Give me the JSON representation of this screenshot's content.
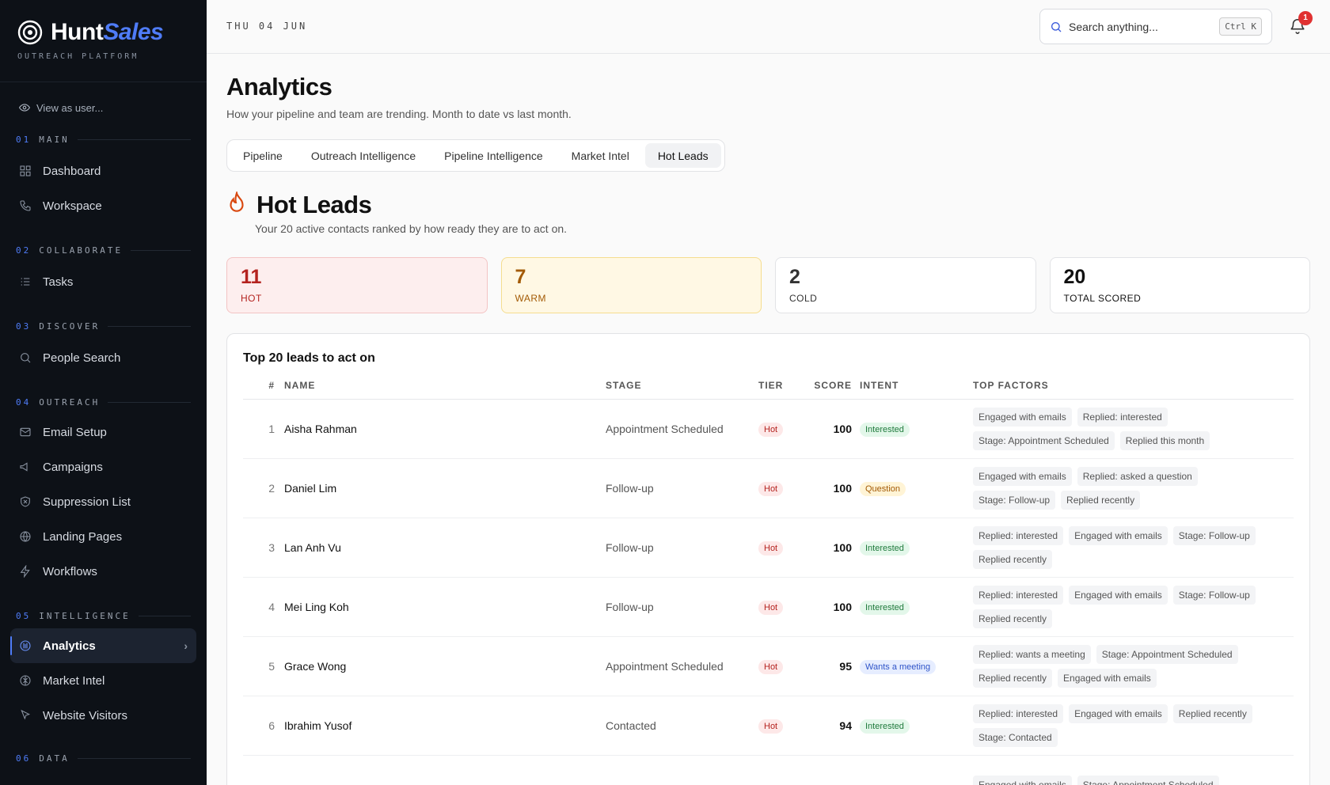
{
  "brand": {
    "name_part1": "Hunt",
    "name_part2": "Sales",
    "tagline": "OUTREACH PLATFORM"
  },
  "sidebar": {
    "view_as": "View as user...",
    "sections": [
      {
        "num": "01",
        "label": "MAIN",
        "items": [
          {
            "label": "Dashboard",
            "icon": "grid-icon"
          },
          {
            "label": "Workspace",
            "icon": "phone-icon"
          }
        ]
      },
      {
        "num": "02",
        "label": "COLLABORATE",
        "items": [
          {
            "label": "Tasks",
            "icon": "list-icon"
          }
        ]
      },
      {
        "num": "03",
        "label": "DISCOVER",
        "items": [
          {
            "label": "People Search",
            "icon": "search-icon"
          }
        ]
      },
      {
        "num": "04",
        "label": "OUTREACH",
        "items": [
          {
            "label": "Email Setup",
            "icon": "mail-icon"
          },
          {
            "label": "Campaigns",
            "icon": "megaphone-icon"
          },
          {
            "label": "Suppression List",
            "icon": "shield-icon"
          },
          {
            "label": "Landing Pages",
            "icon": "globe-icon"
          },
          {
            "label": "Workflows",
            "icon": "bolt-icon"
          }
        ]
      },
      {
        "num": "05",
        "label": "INTELLIGENCE",
        "items": [
          {
            "label": "Analytics",
            "icon": "analytics-icon",
            "active": true
          },
          {
            "label": "Market Intel",
            "icon": "brain-icon"
          },
          {
            "label": "Website Visitors",
            "icon": "cursor-icon"
          }
        ]
      },
      {
        "num": "06",
        "label": "DATA",
        "items": []
      }
    ]
  },
  "topbar": {
    "date": "THU 04 JUN",
    "search_placeholder": "Search anything...",
    "shortcut": "Ctrl K",
    "notifications": "1"
  },
  "page": {
    "title": "Analytics",
    "subtitle": "How your pipeline and team are trending. Month to date vs last month."
  },
  "tabs": [
    {
      "label": "Pipeline"
    },
    {
      "label": "Outreach Intelligence"
    },
    {
      "label": "Pipeline Intelligence"
    },
    {
      "label": "Market Intel"
    },
    {
      "label": "Hot Leads",
      "active": true
    }
  ],
  "hot_leads": {
    "title": "Hot Leads",
    "subtitle": "Your 20 active contacts ranked by how ready they are to act on.",
    "stats": [
      {
        "value": "11",
        "label": "HOT",
        "kind": "hot"
      },
      {
        "value": "7",
        "label": "WARM",
        "kind": "warm"
      },
      {
        "value": "2",
        "label": "COLD",
        "kind": "cold"
      },
      {
        "value": "20",
        "label": "TOTAL SCORED",
        "kind": "total"
      }
    ]
  },
  "table": {
    "title": "Top 20 leads to act on",
    "columns": {
      "num": "#",
      "name": "NAME",
      "stage": "STAGE",
      "tier": "TIER",
      "score": "SCORE",
      "intent": "INTENT",
      "factors": "TOP FACTORS"
    },
    "rows": [
      {
        "num": "1",
        "name": "Aisha Rahman",
        "stage": "Appointment Scheduled",
        "tier": "Hot",
        "score": "100",
        "intent": "Interested",
        "intent_kind": "green",
        "factors": [
          "Engaged with emails",
          "Replied: interested",
          "Stage: Appointment Scheduled",
          "Replied this month"
        ]
      },
      {
        "num": "2",
        "name": "Daniel Lim",
        "stage": "Follow-up",
        "tier": "Hot",
        "score": "100",
        "intent": "Question",
        "intent_kind": "yellow",
        "factors": [
          "Engaged with emails",
          "Replied: asked a question",
          "Stage: Follow-up",
          "Replied recently"
        ]
      },
      {
        "num": "3",
        "name": "Lan Anh Vu",
        "stage": "Follow-up",
        "tier": "Hot",
        "score": "100",
        "intent": "Interested",
        "intent_kind": "green",
        "factors": [
          "Replied: interested",
          "Engaged with emails",
          "Stage: Follow-up",
          "Replied recently"
        ]
      },
      {
        "num": "4",
        "name": "Mei Ling Koh",
        "stage": "Follow-up",
        "tier": "Hot",
        "score": "100",
        "intent": "Interested",
        "intent_kind": "green",
        "factors": [
          "Replied: interested",
          "Engaged with emails",
          "Stage: Follow-up",
          "Replied recently"
        ]
      },
      {
        "num": "5",
        "name": "Grace Wong",
        "stage": "Appointment Scheduled",
        "tier": "Hot",
        "score": "95",
        "intent": "Wants a meeting",
        "intent_kind": "blue",
        "factors": [
          "Replied: wants a meeting",
          "Stage: Appointment Scheduled",
          "Replied recently",
          "Engaged with emails"
        ]
      },
      {
        "num": "6",
        "name": "Ibrahim Yusof",
        "stage": "Contacted",
        "tier": "Hot",
        "score": "94",
        "intent": "Interested",
        "intent_kind": "green",
        "factors": [
          "Replied: interested",
          "Engaged with emails",
          "Replied recently",
          "Stage: Contacted"
        ]
      },
      {
        "num": "",
        "name": "",
        "stage": "",
        "tier": "",
        "score": "",
        "intent": "",
        "intent_kind": "",
        "factors": [
          "Engaged with emails",
          "Stage: Appointment Scheduled"
        ]
      }
    ]
  },
  "colors": {
    "accent": "#4f7cf7",
    "sidebar_bg": "#0d1117",
    "hot": "#b4231f",
    "warm": "#a35a05"
  }
}
